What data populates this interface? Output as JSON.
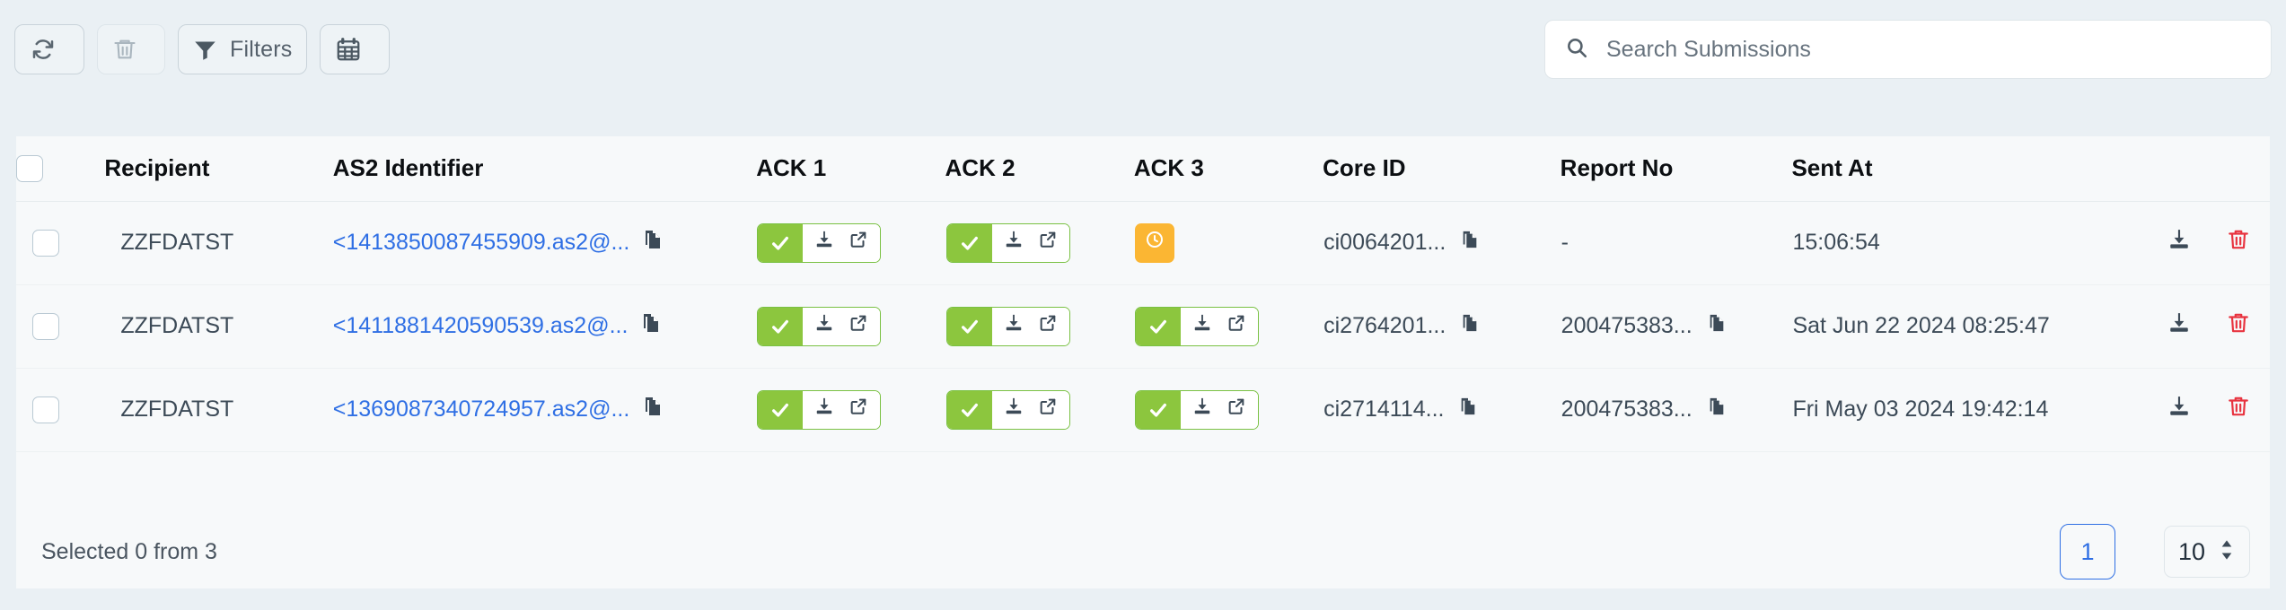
{
  "toolbar": {
    "refresh_label": "",
    "delete_label": "",
    "filters_label": "Filters",
    "calendar_label": ""
  },
  "search": {
    "placeholder": "Search Submissions",
    "value": ""
  },
  "table": {
    "columns": [
      {
        "key": "select",
        "label": ""
      },
      {
        "key": "recipient",
        "label": "Recipient"
      },
      {
        "key": "as2",
        "label": "AS2 Identifier"
      },
      {
        "key": "ack1",
        "label": "ACK 1"
      },
      {
        "key": "ack2",
        "label": "ACK 2"
      },
      {
        "key": "ack3",
        "label": "ACK 3"
      },
      {
        "key": "coreid",
        "label": "Core ID"
      },
      {
        "key": "reportno",
        "label": "Report No"
      },
      {
        "key": "sentat",
        "label": "Sent At"
      },
      {
        "key": "actions",
        "label": ""
      }
    ],
    "rows": [
      {
        "selected": false,
        "recipient": "ZZFDATST",
        "as2": "<1413850087455909.as2@...",
        "ack1": "complete",
        "ack2": "complete",
        "ack3": "pending",
        "coreid": "ci0064201...",
        "reportno": "-",
        "reportno_has_copy": false,
        "sentat": "15:06:54"
      },
      {
        "selected": false,
        "recipient": "ZZFDATST",
        "as2": "<1411881420590539.as2@...",
        "ack1": "complete",
        "ack2": "complete",
        "ack3": "complete",
        "coreid": "ci2764201...",
        "reportno": "200475383...",
        "reportno_has_copy": true,
        "sentat": "Sat Jun 22 2024 08:25:47"
      },
      {
        "selected": false,
        "recipient": "ZZFDATST",
        "as2": "<1369087340724957.as2@...",
        "ack1": "complete",
        "ack2": "complete",
        "ack3": "complete",
        "coreid": "ci2714114...",
        "reportno": "200475383...",
        "reportno_has_copy": true,
        "sentat": "Fri May 03 2024 19:42:14"
      }
    ]
  },
  "footer": {
    "selection_text": "Selected 0 from 3",
    "current_page": "1",
    "page_size": "10"
  },
  "icons": {
    "refresh": "refresh-icon",
    "trash": "trash-icon",
    "filter": "filter-icon",
    "calendar": "calendar-icon",
    "search": "search-icon",
    "copy": "copy-icon",
    "check": "check-icon",
    "clock": "clock-icon",
    "download": "download-icon",
    "external": "external-link-icon",
    "delete": "delete-icon",
    "stepper": "stepper-arrows-icon"
  },
  "colors": {
    "page_bg": "#eaf0f4",
    "card_bg": "#f7f9fa",
    "link": "#2f6fe4",
    "ack_success": "#8cc63e",
    "ack_success_border": "#7ac143",
    "ack_pending": "#fbb633",
    "delete_red": "#e8333f",
    "icon_dark": "#3c4a57",
    "text_dark": "#0c0f12"
  }
}
